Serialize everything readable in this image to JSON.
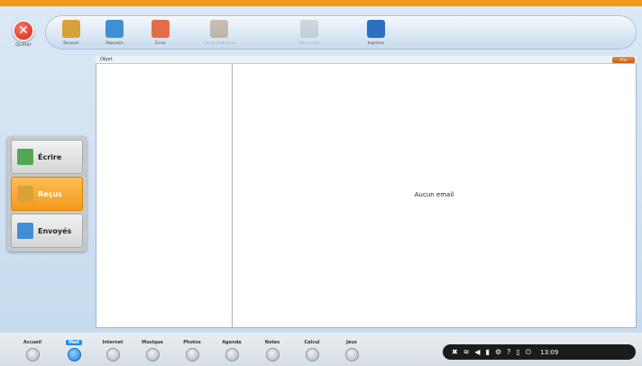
{
  "close": {
    "label": "Quitter"
  },
  "toolbar": {
    "items": [
      {
        "label": "Recevoir",
        "color": "#d8a13a"
      },
      {
        "label": "Répondre",
        "color": "#3f8fd6"
      },
      {
        "label": "Écrire",
        "color": "#e36d4a"
      },
      {
        "label": "Carnet d'adresses",
        "color": "#8a5a2c"
      },
      {
        "label": "Pièce jointe",
        "color": "#9aa3ad"
      },
      {
        "label": "Imprimer",
        "color": "#2b6fc2"
      }
    ]
  },
  "folders": [
    {
      "label": "Écrire",
      "color": "#52a852"
    },
    {
      "label": "Reçus",
      "color": "#d8a13a"
    },
    {
      "label": "Envoyés",
      "color": "#3f8fd6"
    }
  ],
  "list": {
    "header": "Objet",
    "sort_label": "Trier"
  },
  "reader": {
    "empty_message": "Aucun email"
  },
  "dock": {
    "items": [
      {
        "label": "Accueil"
      },
      {
        "label": "Mail"
      },
      {
        "label": "Internet"
      },
      {
        "label": "Musique"
      },
      {
        "label": "Photos"
      },
      {
        "label": "Agenda"
      },
      {
        "label": "Notes"
      },
      {
        "label": "Calcul"
      },
      {
        "label": "Jeux"
      }
    ]
  },
  "tray": {
    "time": "13:09"
  },
  "colors": {
    "accent": "#f39a1c",
    "dock_active": "#1f8fe0"
  }
}
